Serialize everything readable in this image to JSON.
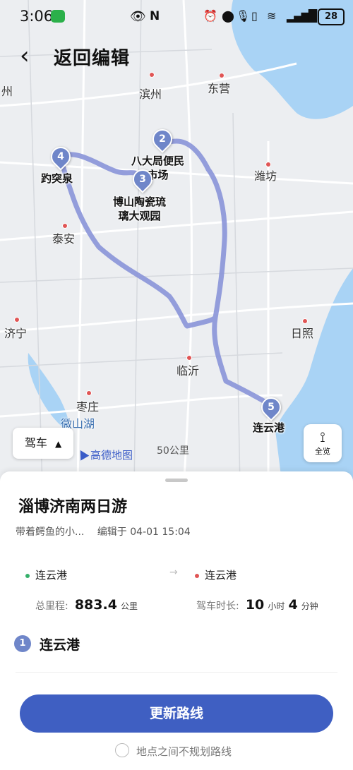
{
  "status_bar": {
    "time": "3:06",
    "icons": "👁 N ⏰ ● 🎤 ▯ 📶 ▮",
    "battery": "28"
  },
  "header": {
    "back_icon": "‹",
    "title": "返回编辑"
  },
  "map": {
    "cities": [
      "滨州",
      "东营",
      "潍坊",
      "泰安",
      "济宁",
      "日照",
      "临沂",
      "枣庄",
      "微山湖",
      "州",
      "徐州"
    ],
    "pois": [
      {
        "num": "2",
        "label": "八大局便民\n市场"
      },
      {
        "num": "3",
        "label": "博山陶瓷琉\n璃大观园"
      },
      {
        "num": "4",
        "label": "趵突泉"
      },
      {
        "num": "5",
        "label": "连云港"
      }
    ],
    "drive_label": "驾车",
    "drive_icon": "▲",
    "overview_label": "全览",
    "brand": "高德地图",
    "scale": "50公里",
    "route_color": "#8a94d8"
  },
  "trip": {
    "name": "淄博济南两日游",
    "author": "带着鳄鱼的小...",
    "edited": "编辑于 04-01 15:04",
    "from": "连云港",
    "to": "连云港",
    "arrow": "→",
    "distance_label": "总里程:",
    "distance_value": "883.4",
    "distance_unit": "公里",
    "duration_label": "驾车时长:",
    "duration_hours": "10",
    "duration_hours_unit": "小时",
    "duration_minutes": "4",
    "duration_minutes_unit": "分钟"
  },
  "stops": [
    {
      "num": "1",
      "name": "连云港"
    }
  ],
  "actions": {
    "update_button": "更新路线",
    "no_route_checkbox": "地点之间不规划路线"
  }
}
